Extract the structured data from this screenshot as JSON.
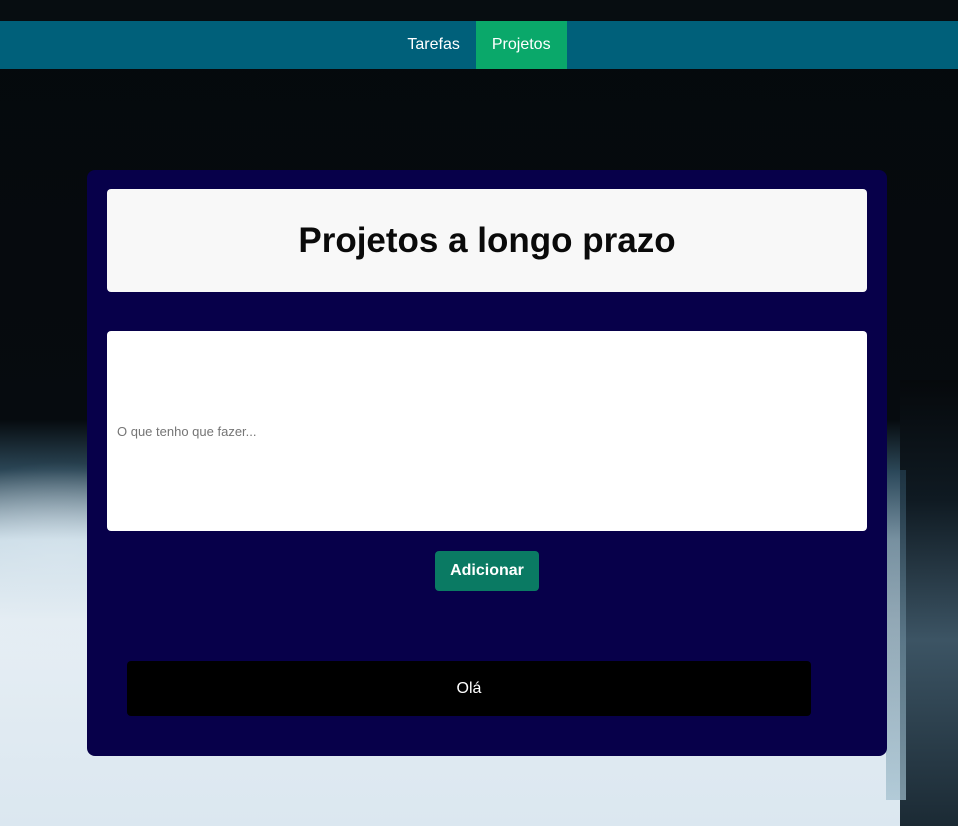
{
  "nav": {
    "items": [
      {
        "label": "Tarefas",
        "active": false
      },
      {
        "label": "Projetos",
        "active": true
      }
    ],
    "colors": {
      "bar": "#00607a",
      "active": "#0aa86a"
    }
  },
  "card": {
    "title": "Projetos a longo prazo",
    "input": {
      "placeholder": "O que tenho que fazer...",
      "value": ""
    },
    "add_button_label": "Adicionar",
    "items": [
      {
        "text": "Olá"
      }
    ],
    "colors": {
      "background": "#07004a",
      "button": "#0a7a63"
    }
  }
}
